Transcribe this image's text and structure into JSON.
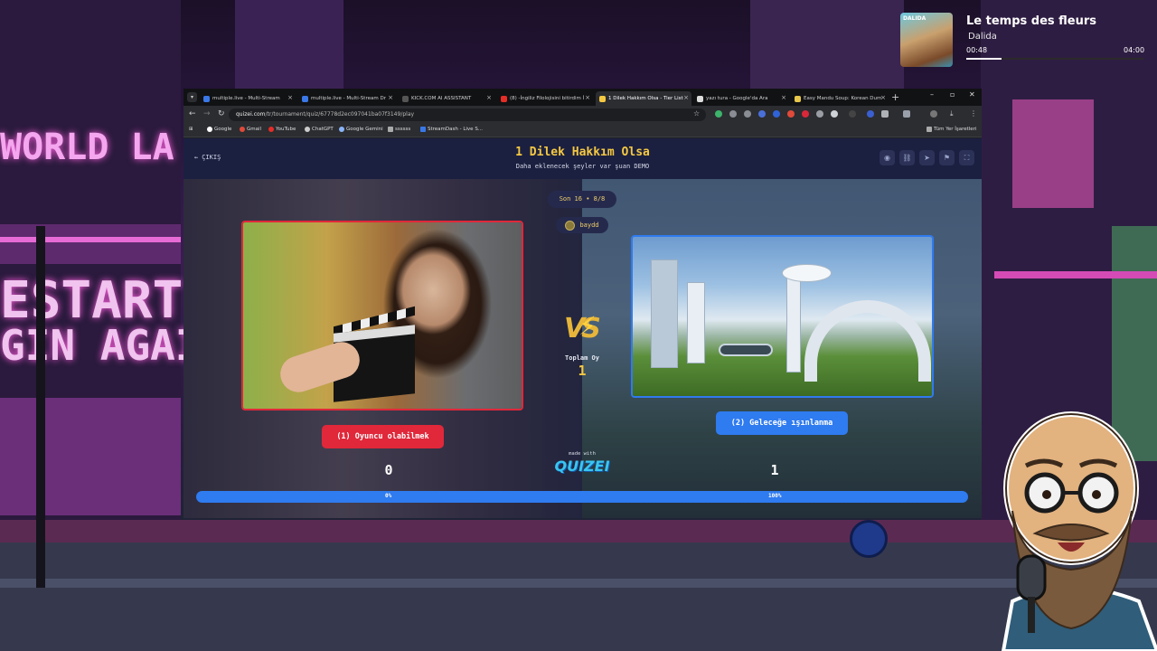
{
  "now_playing": {
    "title": "Le temps des fleurs",
    "artist": "Dalida",
    "cover_text": "DALIDA",
    "elapsed": "00:48",
    "duration": "04:00",
    "progress": 0.2
  },
  "background": {
    "sign_1": "WORLD LA",
    "sign_2": "ESTART",
    "sign_3": "GIN AGAIN"
  },
  "browser": {
    "tabs": [
      {
        "label": "multiple.live - Multi-Stream",
        "fav": "#3a78e7"
      },
      {
        "label": "multiple.live - Multi-Stream Dr",
        "fav": "#3a78e7"
      },
      {
        "label": "KICK.COM AI ASSISTANT",
        "fav": "#555"
      },
      {
        "label": "(8) -İngiliz Filolojisini bitirdim İ",
        "fav": "#e52d27"
      },
      {
        "label": "1 Dilek Hakkım Olsa - Tier List",
        "fav": "#f5c842"
      },
      {
        "label": "yazı tura - Google'da Ara",
        "fav": "#dddddd"
      },
      {
        "label": "Easy Mandu Soup: Korean Dum",
        "fav": "#e7c84a"
      }
    ],
    "address": {
      "host": "quizei.com",
      "path": "/tr/tournament/quiz/67778d2ec097041ba07f3149/play"
    },
    "bookmarks": [
      "Google",
      "Gmail",
      "YouTube",
      "ChatGPT",
      "Google Gemini",
      "ssssss",
      "StreamDash - Live S..."
    ],
    "all_bookmarks": "Tüm Yer İşaretleri"
  },
  "page": {
    "back_label": "ÇIKIŞ",
    "title": "1 Dilek Hakkım Olsa",
    "subtitle": "Daha eklenecek şeyler var şuan DEMO",
    "round": "Son 16 • 8/8",
    "username": "baydd",
    "total_label": "Toplam Oy",
    "total_votes": "1",
    "left_choice": "(1) Oyuncu olabilmek",
    "right_choice": "(2) Geleceğe ışınlanma",
    "left_score": "0",
    "right_score": "1",
    "made_with": "made with",
    "logo": "QUIZEI",
    "left_percent_label": "0%",
    "right_percent_label": "100%",
    "left_fraction": 0.0,
    "colors": {
      "left": "#e0283a",
      "right": "#2f7bf0",
      "accent": "#f5c842"
    },
    "header_icons": [
      "eye-icon",
      "link-icon",
      "send-icon",
      "flag-icon",
      "fullscreen-icon"
    ]
  }
}
